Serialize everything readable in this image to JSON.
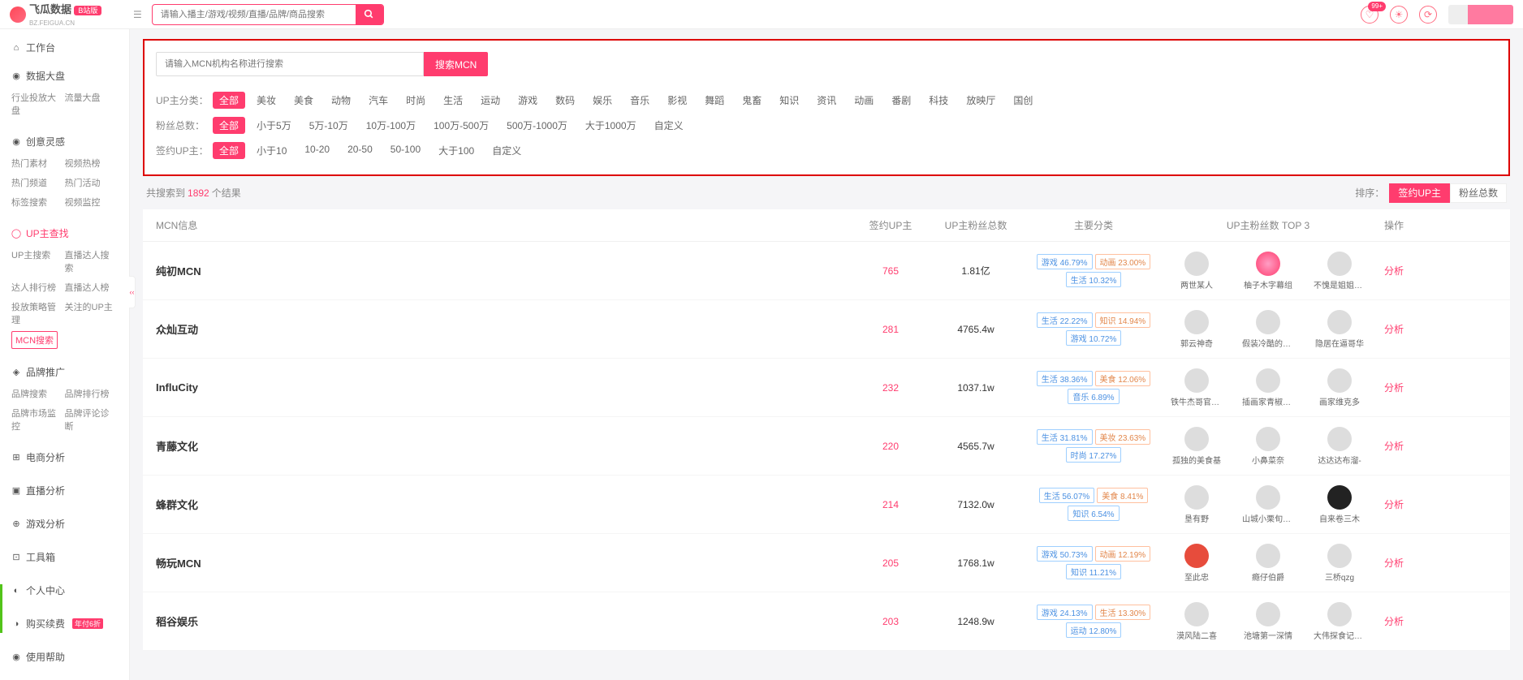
{
  "header": {
    "logo_text": "飞瓜数据",
    "logo_sub": "BZ.FEIGUA.CN",
    "logo_badge": "B站版",
    "search_placeholder": "请输入播主/游戏/视频/直播/品牌/商品搜索",
    "badge_count": "99+"
  },
  "sidebar": {
    "worktable": "工作台",
    "groups": [
      {
        "title": "数据大盘",
        "children": [
          "行业投放大盘",
          "流量大盘"
        ]
      },
      {
        "title": "创意灵感",
        "children": [
          "热门素材",
          "视频热榜",
          "热门频道",
          "热门活动",
          "标签搜索",
          "视频监控"
        ]
      },
      {
        "title": "UP主查找",
        "active": true,
        "children": [
          "UP主搜索",
          "直播达人搜索",
          "达人排行榜",
          "直播达人榜",
          "投放策略管理",
          "关注的UP主"
        ],
        "active_child": "MCN搜索"
      },
      {
        "title": "品牌推广",
        "children": [
          "品牌搜索",
          "品牌排行榜",
          "品牌市场监控",
          "品牌评论诊断"
        ]
      },
      {
        "title": "电商分析",
        "children": []
      },
      {
        "title": "直播分析",
        "children": []
      },
      {
        "title": "游戏分析",
        "children": []
      },
      {
        "title": "工具箱",
        "children": []
      },
      {
        "title": "个人中心",
        "children": []
      },
      {
        "title": "购买续费",
        "hot": "年付6折",
        "children": []
      },
      {
        "title": "使用帮助",
        "children": []
      }
    ]
  },
  "filters": {
    "mcn_placeholder": "请输入MCN机构名称进行搜索",
    "mcn_button": "搜索MCN",
    "rows": [
      {
        "label": "UP主分类：",
        "selected": "全部",
        "opts": [
          "全部",
          "美妆",
          "美食",
          "动物",
          "汽车",
          "时尚",
          "生活",
          "运动",
          "游戏",
          "数码",
          "娱乐",
          "音乐",
          "影视",
          "舞蹈",
          "鬼畜",
          "知识",
          "资讯",
          "动画",
          "番剧",
          "科技",
          "放映厅",
          "国创"
        ]
      },
      {
        "label": "粉丝总数：",
        "selected": "全部",
        "opts": [
          "全部",
          "小于5万",
          "5万-10万",
          "10万-100万",
          "100万-500万",
          "500万-1000万",
          "大于1000万",
          "自定义"
        ]
      },
      {
        "label": "签约UP主：",
        "selected": "全部",
        "opts": [
          "全部",
          "小于10",
          "10-20",
          "20-50",
          "50-100",
          "大于100",
          "自定义"
        ]
      }
    ]
  },
  "results": {
    "prefix": "共搜索到",
    "count": "1892",
    "suffix": "个结果",
    "sort_label": "排序：",
    "sort_opts": [
      "签约UP主",
      "粉丝总数"
    ],
    "sort_active": "签约UP主"
  },
  "table": {
    "headers": {
      "mcn": "MCN信息",
      "up": "签约UP主",
      "fans": "UP主粉丝总数",
      "cat": "主要分类",
      "top3": "UP主粉丝数 TOP 3",
      "op": "操作"
    },
    "op_label": "分析",
    "rows": [
      {
        "name": "纯初MCN",
        "up": "765",
        "fans": "1.81亿",
        "tags": [
          {
            "t": "游戏 46.79%"
          },
          {
            "t": "动画 23.00%",
            "alt": true
          },
          {
            "t": "生活 10.32%"
          }
        ],
        "top3": [
          {
            "n": "两世某人"
          },
          {
            "n": "柚子木字幕组",
            "cls": "pink"
          },
          {
            "n": "不愧是姐姐大人"
          }
        ]
      },
      {
        "name": "众灿互动",
        "up": "281",
        "fans": "4765.4w",
        "tags": [
          {
            "t": "生活 22.22%"
          },
          {
            "t": "知识 14.94%",
            "alt": true
          },
          {
            "t": "游戏 10.72%"
          }
        ],
        "top3": [
          {
            "n": "郭云神奇"
          },
          {
            "n": "假装冷酷的赵灵"
          },
          {
            "n": "隐居在逼哥华"
          }
        ]
      },
      {
        "name": "InfluCity",
        "up": "232",
        "fans": "1037.1w",
        "tags": [
          {
            "t": "生活 38.36%"
          },
          {
            "t": "美食 12.06%",
            "alt": true
          },
          {
            "t": "音乐 6.89%"
          }
        ],
        "top3": [
          {
            "n": "铁牛杰哥官方…"
          },
          {
            "n": "插画家青椒香菜"
          },
          {
            "n": "画家维克多"
          }
        ]
      },
      {
        "name": "青藤文化",
        "up": "220",
        "fans": "4565.7w",
        "tags": [
          {
            "t": "生活 31.81%"
          },
          {
            "t": "美妆 23.63%",
            "alt": true
          },
          {
            "t": "时尚 17.27%"
          }
        ],
        "top3": [
          {
            "n": "孤独的美食基"
          },
          {
            "n": "小鼻菜奈"
          },
          {
            "n": "达达达布溜-"
          }
        ]
      },
      {
        "name": "蜂群文化",
        "up": "214",
        "fans": "7132.0w",
        "tags": [
          {
            "t": "生活 56.07%"
          },
          {
            "t": "美食 8.41%",
            "alt": true
          },
          {
            "t": "知识 6.54%"
          }
        ],
        "top3": [
          {
            "n": "垦有野"
          },
          {
            "n": "山城小栗旬的…"
          },
          {
            "n": "自来卷三木",
            "cls": "dark"
          }
        ]
      },
      {
        "name": "畅玩MCN",
        "up": "205",
        "fans": "1768.1w",
        "tags": [
          {
            "t": "游戏 50.73%"
          },
          {
            "t": "动画 12.19%",
            "alt": true
          },
          {
            "t": "知识 11.21%"
          }
        ],
        "top3": [
          {
            "n": "至此忠",
            "cls": "red"
          },
          {
            "n": "瘾仔伯爵"
          },
          {
            "n": "三桥qzg"
          }
        ]
      },
      {
        "name": "稻谷娱乐",
        "up": "203",
        "fans": "1248.9w",
        "tags": [
          {
            "t": "游戏 24.13%"
          },
          {
            "t": "生活 13.30%",
            "alt": true
          },
          {
            "t": "运动 12.80%"
          }
        ],
        "top3": [
          {
            "n": "漠风陆二喜"
          },
          {
            "n": "池塘第一深情"
          },
          {
            "n": "大伟探食记官方"
          }
        ]
      }
    ]
  }
}
